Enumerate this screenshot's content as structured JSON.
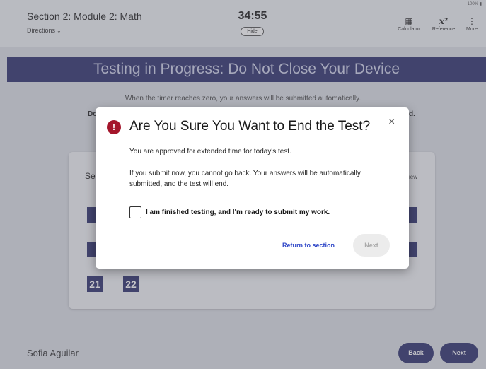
{
  "header": {
    "section_title": "Section 2: Module 2: Math",
    "directions_label": "Directions",
    "timer": "34:55",
    "hide_label": "Hide",
    "tools": [
      {
        "label": "Calculator",
        "icon": "calculator-icon"
      },
      {
        "label": "Reference",
        "icon": "formula-reference-icon"
      },
      {
        "label": "More",
        "icon": "more-vertical-icon"
      }
    ],
    "battery_status": "100%"
  },
  "banner": {
    "text": "Testing in Progress: Do Not Close Your Device"
  },
  "body_info": {
    "line1": "When the timer reaches zero, your answers will be submitted automatically.",
    "line2_left": "Do",
    "line2_right": "d."
  },
  "navigator": {
    "title_partial": "Se",
    "review_partial": "iew",
    "visible_questions": [
      "21",
      "22"
    ]
  },
  "footer": {
    "student_name": "Sofia Aguilar",
    "back_label": "Back",
    "next_label": "Next"
  },
  "modal": {
    "icon": "!",
    "title": "Are You Sure You Want to End the Test?",
    "close_icon": "×",
    "paragraph1": "You are approved for extended time for today's test.",
    "paragraph2": "If you submit now, you cannot go back. Your answers will be automatically submitted, and the test will end.",
    "checkbox_label": "I am finished testing, and I'm ready to submit my work.",
    "checkbox_checked": false,
    "return_label": "Return to section",
    "next_label": "Next"
  },
  "colors": {
    "brand_navy": "#2c2f6d",
    "warning_red": "#a4152b",
    "link_blue": "#2f47c8"
  }
}
